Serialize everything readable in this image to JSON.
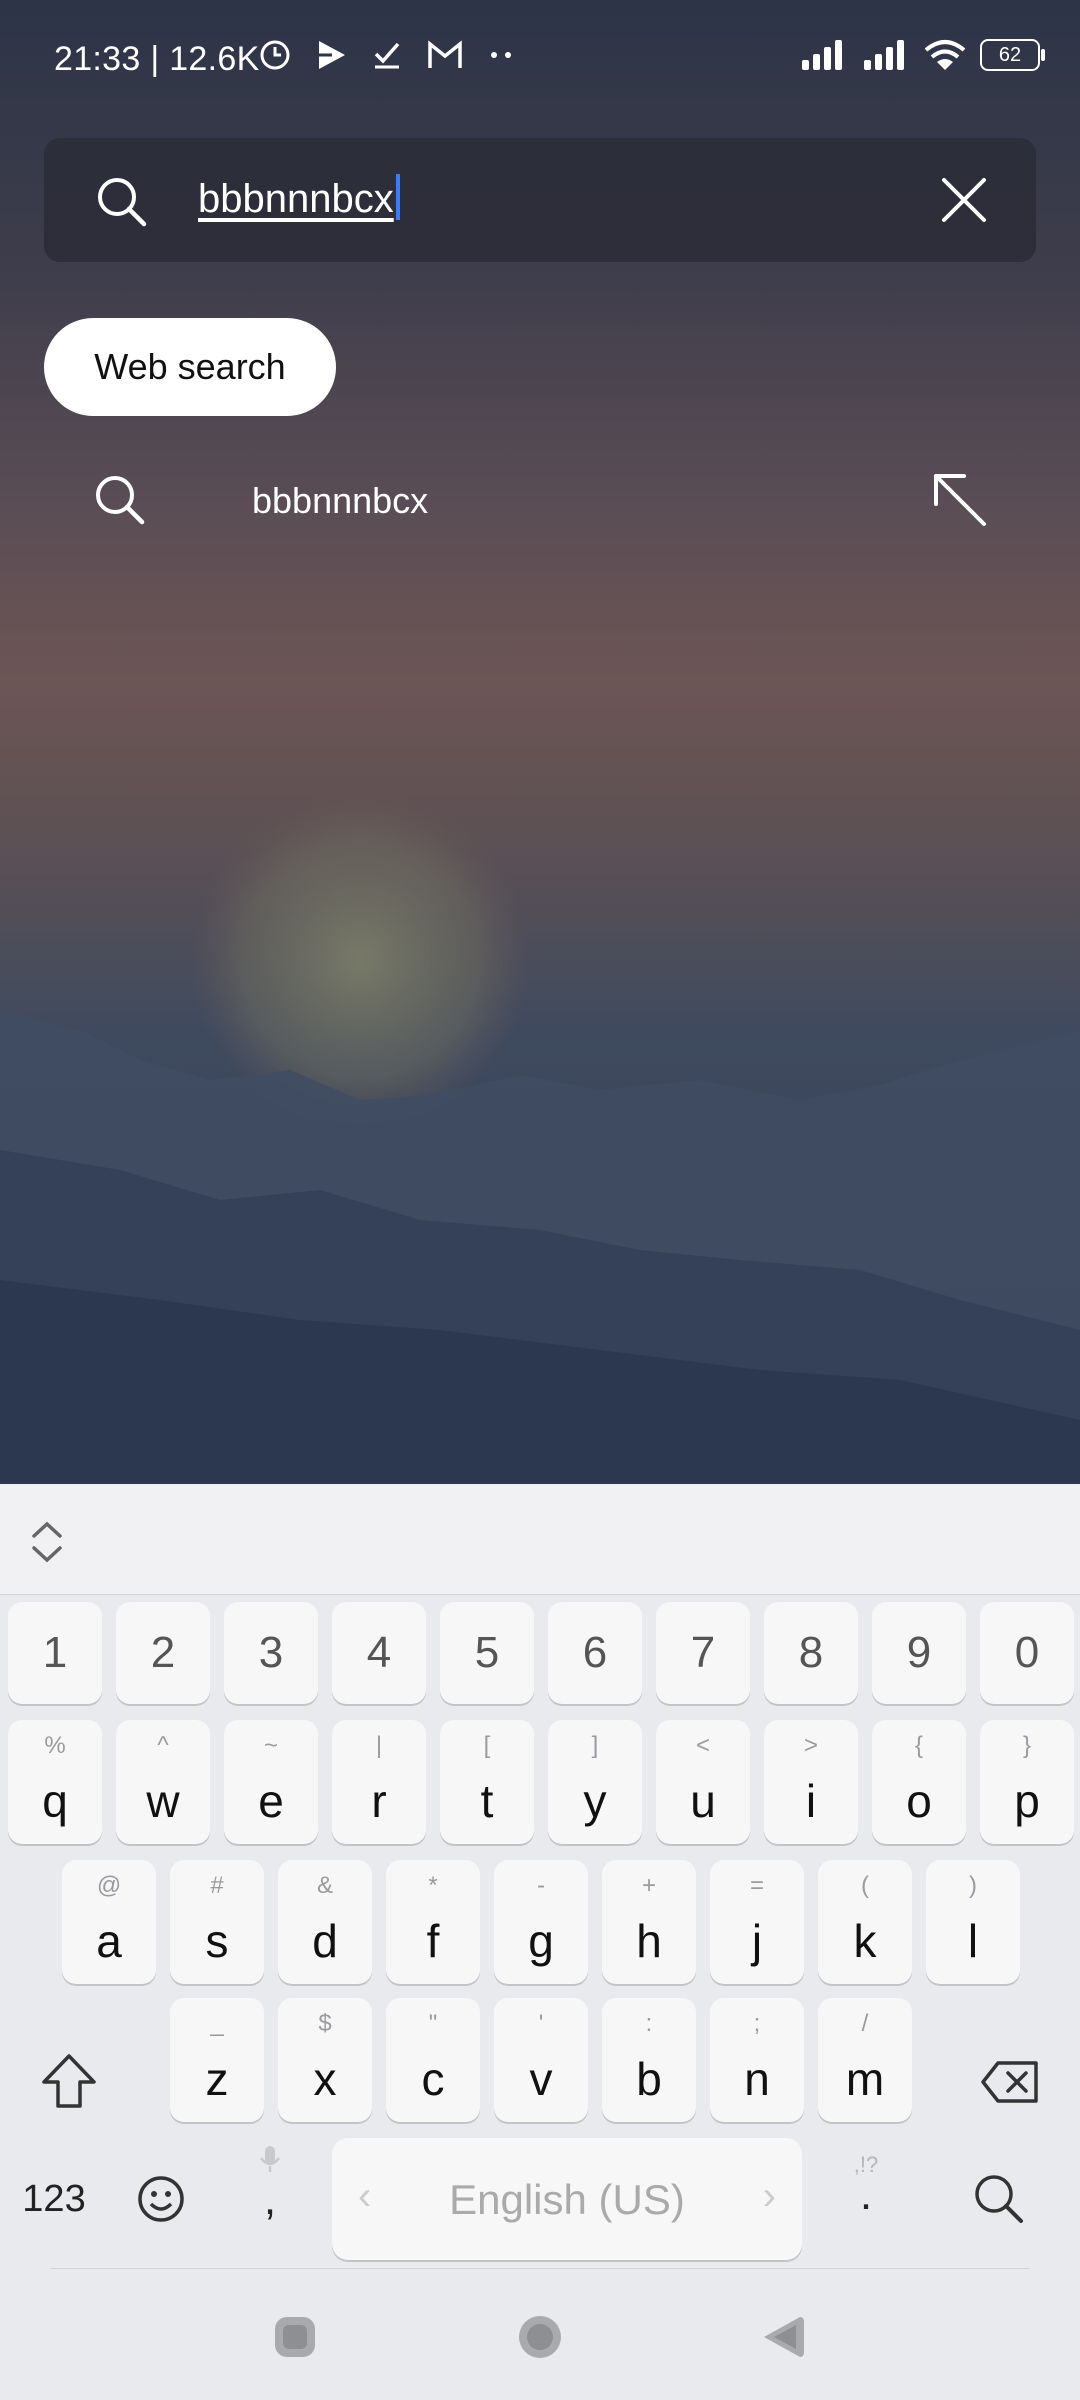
{
  "status_bar": {
    "time": "21:33 | 12.6K",
    "battery": "62",
    "icons": [
      "clock-icon",
      "play-icon",
      "check-icon",
      "gmail-icon",
      "more-dots-icon",
      "signal-icon",
      "signal-icon",
      "wifi-icon",
      "battery-icon"
    ]
  },
  "search": {
    "query": "bbbnnnbcx",
    "clear_icon": "close-icon"
  },
  "chip": {
    "label": "Web search"
  },
  "suggestion": {
    "label": "bbbnnnbcx"
  },
  "keyboard": {
    "numbers": [
      "1",
      "2",
      "3",
      "4",
      "5",
      "6",
      "7",
      "8",
      "9",
      "0"
    ],
    "row1": [
      {
        "main": "q",
        "sub": "%"
      },
      {
        "main": "w",
        "sub": "^"
      },
      {
        "main": "e",
        "sub": "~"
      },
      {
        "main": "r",
        "sub": "|"
      },
      {
        "main": "t",
        "sub": "["
      },
      {
        "main": "y",
        "sub": "]"
      },
      {
        "main": "u",
        "sub": "<"
      },
      {
        "main": "i",
        "sub": ">"
      },
      {
        "main": "o",
        "sub": "{"
      },
      {
        "main": "p",
        "sub": "}"
      }
    ],
    "row2": [
      {
        "main": "a",
        "sub": "@"
      },
      {
        "main": "s",
        "sub": "#"
      },
      {
        "main": "d",
        "sub": "&"
      },
      {
        "main": "f",
        "sub": "*"
      },
      {
        "main": "g",
        "sub": "-"
      },
      {
        "main": "h",
        "sub": "+"
      },
      {
        "main": "j",
        "sub": "="
      },
      {
        "main": "k",
        "sub": "("
      },
      {
        "main": "l",
        "sub": ")"
      }
    ],
    "row3": [
      {
        "main": "z",
        "sub": "_"
      },
      {
        "main": "x",
        "sub": "$"
      },
      {
        "main": "c",
        "sub": "\""
      },
      {
        "main": "v",
        "sub": "'"
      },
      {
        "main": "b",
        "sub": ":"
      },
      {
        "main": "n",
        "sub": ";"
      },
      {
        "main": "m",
        "sub": "/"
      }
    ],
    "symbols_key": "123",
    "comma": ",",
    "period": ".",
    "period_sub": ",!?",
    "space_label": "English (US)",
    "left_arrow": "‹",
    "right_arrow": "›"
  }
}
